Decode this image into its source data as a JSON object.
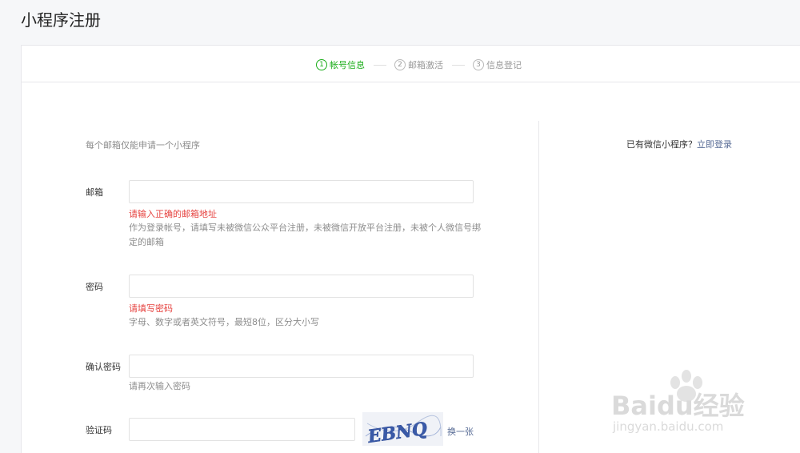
{
  "page": {
    "title": "小程序注册"
  },
  "steps": [
    {
      "num": "1",
      "label": "帐号信息",
      "active": true
    },
    {
      "num": "2",
      "label": "邮箱激活",
      "active": false
    },
    {
      "num": "3",
      "label": "信息登记",
      "active": false
    }
  ],
  "form": {
    "intro": "每个邮箱仅能申请一个小程序",
    "email": {
      "label": "邮箱",
      "value": "",
      "error": "请输入正确的邮箱地址",
      "tip": "作为登录帐号，请填写未被微信公众平台注册，未被微信开放平台注册，未被个人微信号绑定的邮箱"
    },
    "password": {
      "label": "密码",
      "value": "",
      "error": "请填写密码",
      "tip": "字母、数字或者英文符号，最短8位，区分大小写"
    },
    "confirm": {
      "label": "确认密码",
      "value": "",
      "tip": "请再次输入密码"
    },
    "captcha": {
      "label": "验证码",
      "value": "",
      "image_text": "EBNQ",
      "refresh_label": "换一张"
    }
  },
  "sidebar": {
    "prompt": "已有微信小程序？",
    "login_link": "立即登录"
  },
  "watermark": {
    "brand": "Baidu经验",
    "url": "jingyan.baidu.com"
  },
  "colors": {
    "accent": "#1aad19",
    "error": "#e64340",
    "link": "#576b95"
  }
}
